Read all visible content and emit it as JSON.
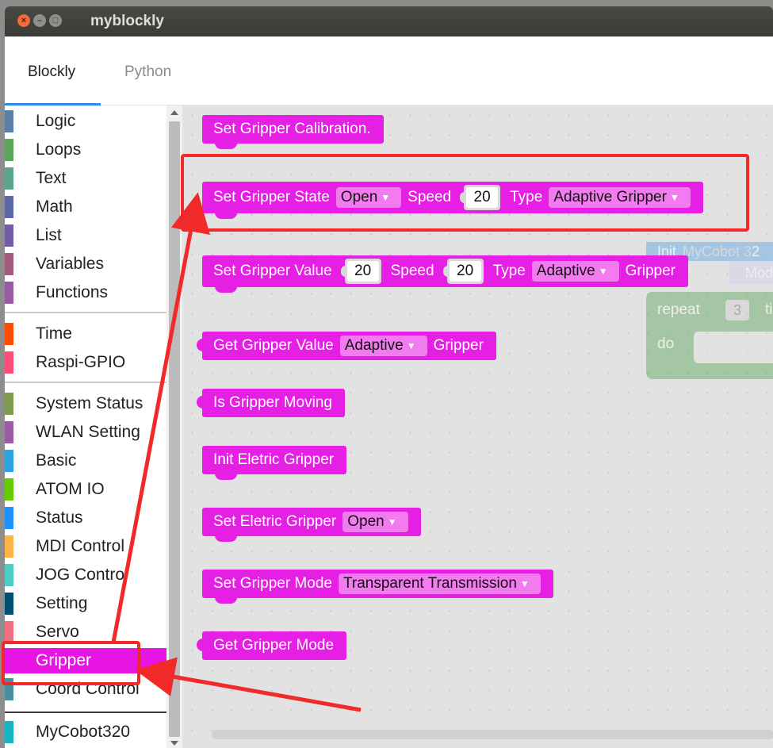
{
  "window": {
    "title": "myblockly"
  },
  "tabs": [
    {
      "label": "Blockly",
      "active": true
    },
    {
      "label": "Python",
      "active": false
    }
  ],
  "toolbox": {
    "categories": [
      {
        "label": "Logic",
        "color": "#5b80a5"
      },
      {
        "label": "Loops",
        "color": "#5ba55b"
      },
      {
        "label": "Text",
        "color": "#5ba58c"
      },
      {
        "label": "Math",
        "color": "#5b67a5"
      },
      {
        "label": "List",
        "color": "#745ba5"
      },
      {
        "label": "Variables",
        "color": "#a55b80"
      },
      {
        "label": "Functions",
        "color": "#995ba5"
      },
      {
        "label": "Time",
        "color": "#ff4d00"
      },
      {
        "label": "Raspi-GPIO",
        "color": "#ff4d7a"
      },
      {
        "label": "System Status",
        "color": "#7e9c4e"
      },
      {
        "label": "WLAN Setting",
        "color": "#9c5ba5"
      },
      {
        "label": "Basic",
        "color": "#2aa3e0"
      },
      {
        "label": "ATOM IO",
        "color": "#66cc00"
      },
      {
        "label": "Status",
        "color": "#1e90ff"
      },
      {
        "label": "MDI Control",
        "color": "#ffb347"
      },
      {
        "label": "JOG Control",
        "color": "#4ecdc4"
      },
      {
        "label": "Setting",
        "color": "#005073"
      },
      {
        "label": "Servo",
        "color": "#f07080"
      },
      {
        "label": "Gripper",
        "color": "#e615e3",
        "selected": true
      },
      {
        "label": "Coord Control",
        "color": "#4a8fa0"
      },
      {
        "label": "MyCobot320",
        "color": "#17b3c4"
      }
    ]
  },
  "blocks": {
    "calibration": {
      "label": "Set Gripper Calibration."
    },
    "set_state": {
      "label": "Set Gripper State",
      "state": "Open",
      "speed_label": "Speed",
      "speed": "20",
      "type_label": "Type",
      "type": "Adaptive Gripper"
    },
    "set_value": {
      "label": "Set Gripper Value",
      "value": "20",
      "speed_label": "Speed",
      "speed": "20",
      "type_label": "Type",
      "type": "Adaptive",
      "suffix": "Gripper"
    },
    "get_value": {
      "label": "Get Gripper Value",
      "type": "Adaptive",
      "suffix": "Gripper"
    },
    "is_moving": {
      "label": "Is Gripper Moving"
    },
    "init_electric": {
      "label": "Init Eletric Gripper"
    },
    "set_electric": {
      "label": "Set Eletric Gripper",
      "state": "Open"
    },
    "set_mode": {
      "label": "Set Gripper Mode",
      "mode": "Transparent Transmission"
    },
    "get_mode": {
      "label": "Get Gripper Mode"
    }
  },
  "ghost": {
    "init_label": "Init",
    "init_value": "MyCobot 3",
    "init_digit": "2",
    "mod_label": "Mod",
    "repeat_label": "repeat",
    "repeat_count": "3",
    "times_label": "ti",
    "do_label": "do"
  },
  "annotation_color": "#f22929"
}
